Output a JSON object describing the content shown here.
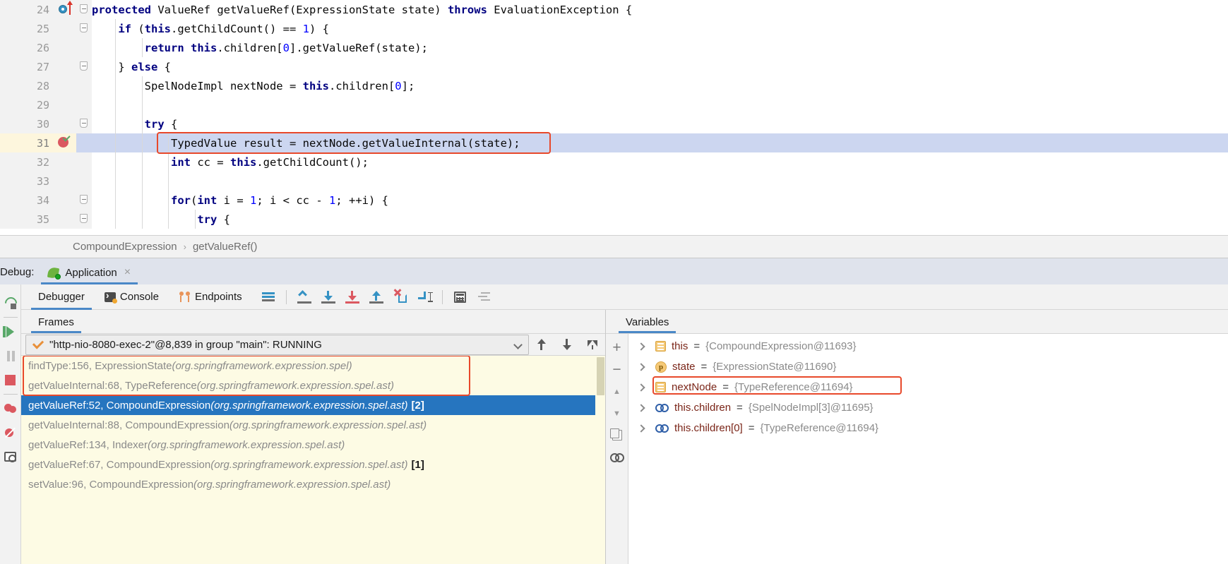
{
  "editor": {
    "lines": [
      {
        "num": "24",
        "indent": 0,
        "text": "protected ValueRef getValueRef(ExpressionState state) throws EvaluationException {",
        "tokens": [
          {
            "t": "protected ",
            "c": "kw"
          },
          {
            "t": "ValueRef getValueRef(ExpressionState state) ",
            "c": "plain"
          },
          {
            "t": "throws ",
            "c": "kw"
          },
          {
            "t": "EvaluationException {",
            "c": "plain"
          }
        ],
        "fold": true,
        "breakpoint_dot": true,
        "exec_arrow": true
      },
      {
        "num": "25",
        "indent": 1,
        "text": "if (this.getChildCount() == 1) {",
        "tokens": [
          {
            "t": "if ",
            "c": "kw"
          },
          {
            "t": "(",
            "c": "plain"
          },
          {
            "t": "this",
            "c": "kw"
          },
          {
            "t": ".getChildCount() == ",
            "c": "plain"
          },
          {
            "t": "1",
            "c": "num"
          },
          {
            "t": ") {",
            "c": "plain"
          }
        ],
        "fold": true
      },
      {
        "num": "26",
        "indent": 2,
        "text": "return this.children[0].getValueRef(state);",
        "tokens": [
          {
            "t": "return ",
            "c": "kw"
          },
          {
            "t": "this",
            "c": "kw"
          },
          {
            "t": ".children[",
            "c": "plain"
          },
          {
            "t": "0",
            "c": "num"
          },
          {
            "t": "].getValueRef(state);",
            "c": "plain"
          }
        ]
      },
      {
        "num": "27",
        "indent": 1,
        "text": "} else {",
        "tokens": [
          {
            "t": "} ",
            "c": "plain"
          },
          {
            "t": "else ",
            "c": "kw"
          },
          {
            "t": "{",
            "c": "plain"
          }
        ],
        "fold": true
      },
      {
        "num": "28",
        "indent": 2,
        "text": "SpelNodeImpl nextNode = this.children[0];",
        "tokens": [
          {
            "t": "SpelNodeImpl nextNode = ",
            "c": "plain"
          },
          {
            "t": "this",
            "c": "kw"
          },
          {
            "t": ".children[",
            "c": "plain"
          },
          {
            "t": "0",
            "c": "num"
          },
          {
            "t": "];",
            "c": "plain"
          }
        ]
      },
      {
        "num": "29",
        "indent": 0,
        "text": "",
        "tokens": []
      },
      {
        "num": "30",
        "indent": 2,
        "text": "try {",
        "tokens": [
          {
            "t": "try ",
            "c": "kw"
          },
          {
            "t": "{",
            "c": "plain"
          }
        ],
        "fold": true
      },
      {
        "num": "31",
        "indent": 3,
        "text": "TypedValue result = nextNode.getValueInternal(state);",
        "tokens": [
          {
            "t": "TypedValue result = nextNode.getValueInternal(state);",
            "c": "plain"
          }
        ],
        "executing": true,
        "breakpoint_hit": true,
        "highlight": true
      },
      {
        "num": "32",
        "indent": 3,
        "text": "int cc = this.getChildCount();",
        "tokens": [
          {
            "t": "int ",
            "c": "kw"
          },
          {
            "t": "cc = ",
            "c": "plain"
          },
          {
            "t": "this",
            "c": "kw"
          },
          {
            "t": ".getChildCount();",
            "c": "plain"
          }
        ]
      },
      {
        "num": "33",
        "indent": 0,
        "text": "",
        "tokens": []
      },
      {
        "num": "34",
        "indent": 3,
        "text": "for(int i = 1; i < cc - 1; ++i) {",
        "tokens": [
          {
            "t": "for",
            "c": "kw"
          },
          {
            "t": "(",
            "c": "plain"
          },
          {
            "t": "int ",
            "c": "kw"
          },
          {
            "t": "i = ",
            "c": "plain"
          },
          {
            "t": "1",
            "c": "num"
          },
          {
            "t": "; i < cc - ",
            "c": "plain"
          },
          {
            "t": "1",
            "c": "num"
          },
          {
            "t": "; ++i) {",
            "c": "plain"
          }
        ],
        "fold": true
      },
      {
        "num": "35",
        "indent": 4,
        "text": "try {",
        "tokens": [
          {
            "t": "try ",
            "c": "kw"
          },
          {
            "t": "{",
            "c": "plain"
          }
        ],
        "fold": true
      }
    ]
  },
  "breadcrumb": {
    "class_name": "CompoundExpression",
    "separator": "›",
    "method_name": "getValueRef()"
  },
  "debug_header": {
    "label": "Debug:",
    "tab_title": "Application",
    "tab_icon": "spring-boot-icon",
    "close_label": "×"
  },
  "left_toolbar": {
    "buttons": [
      {
        "name": "rerun-button",
        "icon": "rerun-icon"
      },
      {
        "name": "resume-program-button",
        "icon": "resume-icon"
      },
      {
        "name": "pause-program-button",
        "icon": "pause-icon"
      },
      {
        "name": "stop-button",
        "icon": "stop-icon"
      },
      {
        "name": "view-breakpoints-button",
        "icon": "breakpoints-icon"
      },
      {
        "name": "mute-breakpoints-button",
        "icon": "mute-breakpoints-icon"
      },
      {
        "name": "screenshot-button",
        "icon": "camera-icon"
      }
    ]
  },
  "debugger_tabs": {
    "tabs": [
      {
        "label": "Debugger",
        "icon": "",
        "active": true
      },
      {
        "label": "Console",
        "icon": "console-icon",
        "active": false
      },
      {
        "label": "Endpoints",
        "icon": "endpoints-icon",
        "active": false
      }
    ],
    "toolbar": [
      {
        "name": "layout-settings-button",
        "icon": "layout-icon"
      },
      {
        "name": "show-execution-point-button",
        "icon": "show-execution-point-icon"
      },
      {
        "name": "step-over-button",
        "icon": "step-over-icon"
      },
      {
        "name": "step-into-button",
        "icon": "step-into-icon"
      },
      {
        "name": "force-step-into-button",
        "icon": "force-step-into-icon"
      },
      {
        "name": "step-out-button",
        "icon": "step-out-icon"
      },
      {
        "name": "drop-frame-button",
        "icon": "drop-frame-icon"
      },
      {
        "name": "run-to-cursor-button",
        "icon": "run-to-cursor-icon"
      },
      {
        "name": "evaluate-expression-button",
        "icon": "calculator-icon"
      },
      {
        "name": "settings-button",
        "icon": "settings-icon"
      }
    ]
  },
  "frames_panel": {
    "tab_label": "Frames",
    "thread": {
      "text": "\"http-nio-8080-exec-2\"@8,839 in group \"main\": RUNNING",
      "status_icon": "orange-check-icon"
    },
    "thread_buttons": [
      {
        "name": "move-frame-up-button",
        "icon": "arrow-up-icon"
      },
      {
        "name": "move-frame-down-button",
        "icon": "arrow-down-icon"
      },
      {
        "name": "filter-frames-button",
        "icon": "filter-icon"
      }
    ],
    "frames": [
      {
        "method": "findType:156, ExpressionState",
        "package": "(org.springframework.expression.spel)",
        "badge": "",
        "selected": false,
        "highlight": true
      },
      {
        "method": "getValueInternal:68, TypeReference",
        "package": "(org.springframework.expression.spel.ast)",
        "badge": "",
        "selected": false,
        "highlight": true
      },
      {
        "method": "getValueRef:52, CompoundExpression",
        "package": "(org.springframework.expression.spel.ast)",
        "badge": "[2]",
        "selected": true,
        "highlight": false
      },
      {
        "method": "getValueInternal:88, CompoundExpression",
        "package": "(org.springframework.expression.spel.ast)",
        "badge": "",
        "selected": false,
        "highlight": false
      },
      {
        "method": "getValueRef:134, Indexer",
        "package": "(org.springframework.expression.spel.ast)",
        "badge": "",
        "selected": false,
        "highlight": false
      },
      {
        "method": "getValueRef:67, CompoundExpression",
        "package": "(org.springframework.expression.spel.ast)",
        "badge": "[1]",
        "selected": false,
        "highlight": false
      },
      {
        "method": "setValue:96, CompoundExpression",
        "package": "(org.springframework.expression.spel.ast)",
        "badge": "",
        "selected": false,
        "highlight": false
      }
    ]
  },
  "variables_panel": {
    "tab_label": "Variables",
    "side_buttons": [
      {
        "name": "add-watch-button",
        "label": "+"
      },
      {
        "name": "remove-watch-button",
        "label": "−"
      },
      {
        "name": "move-watch-up-button",
        "label": "▲"
      },
      {
        "name": "move-watch-down-button",
        "label": "▼"
      },
      {
        "name": "copy-value-button",
        "label": ""
      },
      {
        "name": "watches-button",
        "label": ""
      }
    ],
    "variables": [
      {
        "icon": "field-icon",
        "name": "this",
        "eq": " = ",
        "value": "{CompoundExpression@11693}",
        "highlight": false
      },
      {
        "icon": "parameter-icon",
        "name": "state",
        "eq": " = ",
        "value": "{ExpressionState@11690}",
        "highlight": false
      },
      {
        "icon": "field-icon",
        "name": "nextNode",
        "eq": " = ",
        "value": "{TypeReference@11694}",
        "highlight": true
      },
      {
        "icon": "watch-icon",
        "name": "this.children",
        "eq": " = ",
        "value": "{SpelNodeImpl[3]@11695}",
        "highlight": false
      },
      {
        "icon": "watch-icon",
        "name": "this.children[0]",
        "eq": " = ",
        "value": "{TypeReference@11694}",
        "highlight": false
      }
    ]
  },
  "colors": {
    "accent": "#4a88c7",
    "highlight_red": "#e8492b",
    "selected_frame": "#2675bf",
    "exec_line": "#ccd6f0",
    "frames_bg": "#fdfbe4",
    "keyword": "#000080",
    "number": "#0000ff"
  }
}
